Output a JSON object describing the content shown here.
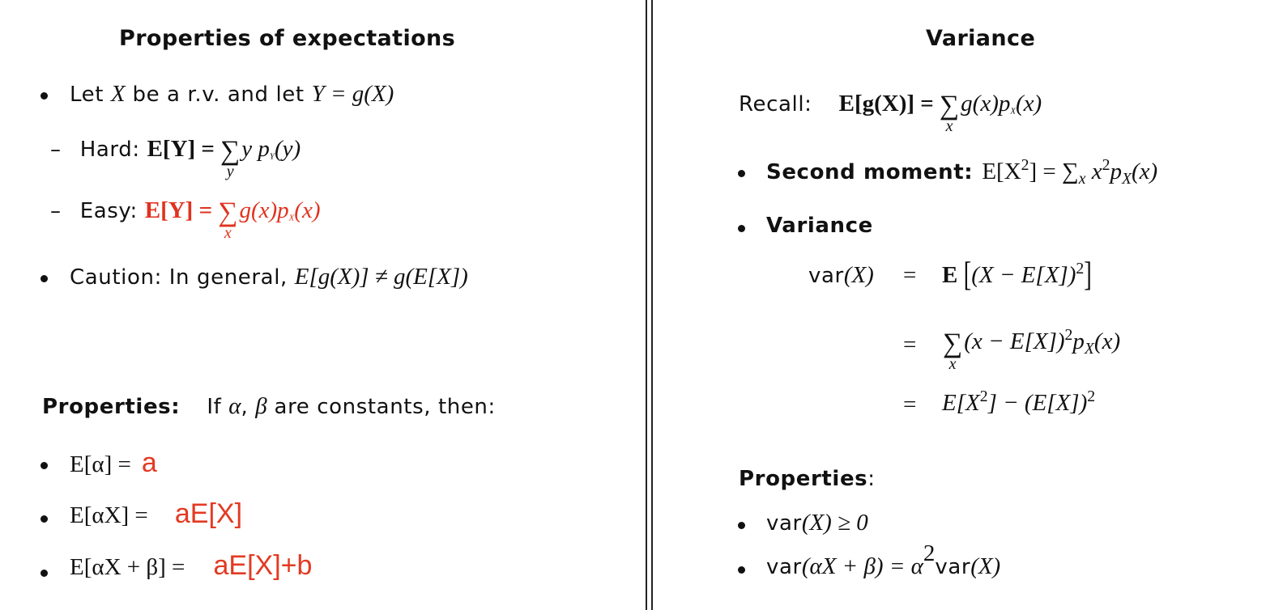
{
  "left": {
    "title": "Properties of expectations",
    "item1": {
      "text1": "Let ",
      "X": "X",
      "text2": " be a r.v. and let ",
      "expr": "Y = g(X)"
    },
    "hard": {
      "dash": "–",
      "label": "Hard: ",
      "lhs": "E[Y] =",
      "sum_sub": "y",
      "rhs": "y p",
      "rhs_sub": "Y",
      "rhs_end": "(y)"
    },
    "easy": {
      "dash": "–",
      "label": "Easy: ",
      "lhs": "E[Y] =",
      "sum_sub": "x",
      "rhs": "g(x)p",
      "rhs_sub": "X",
      "rhs_end": "(x)"
    },
    "caution": {
      "text": "Caution: In general, ",
      "expr": "E[g(X)] ≠ g(E[X])"
    },
    "properties": {
      "label": "Properties:",
      "text1": "If ",
      "alpha": "α",
      "comma": ", ",
      "beta": "β",
      "text2": " are constants, then:"
    },
    "prop1": {
      "expr": "E[α] =",
      "handwritten": "a"
    },
    "prop2": {
      "expr": "E[αX] =",
      "handwritten": "aE[X]"
    },
    "prop3": {
      "expr": "E[αX + β] =",
      "handwritten": "aE[X]+b"
    }
  },
  "right": {
    "title": "Variance",
    "recall": {
      "label": "Recall:",
      "lhs": "E[g(X)] =",
      "sum_sub": "x",
      "rhs": "g(x)p",
      "rhs_sub": "X",
      "rhs_end": "(x)"
    },
    "second_moment": {
      "label": "Second moment:",
      "lhs": "E[X",
      "sup": "2",
      "mid": "] = ∑",
      "sum_sub": "x",
      "rhs": " x",
      "rhs_sup": "2",
      "rhs2": "p",
      "rhs_sub": "X",
      "rhs_end": "(x)"
    },
    "variance_label": "Variance",
    "var_lhs_word": "var",
    "var_lhs_arg": "(X)",
    "eq": "=",
    "line1": {
      "E": "E",
      "body": "(X − E[X])",
      "sup": "2"
    },
    "line2": {
      "sum_sub": "x",
      "body": "(x − E[X])",
      "sup": "2",
      "p": "p",
      "p_sub": "X",
      "end": "(x)"
    },
    "line3": {
      "a": "E[X",
      "sup1": "2",
      "b": "] − (E[X])",
      "sup2": "2"
    },
    "properties_label": "Properties",
    "properties_colon": ":",
    "prop1": {
      "word": "var",
      "expr": "(X) ≥ 0"
    },
    "prop2": {
      "word": "var",
      "expr1": "(αX + β) = α",
      "sup": "2",
      "word2": "var",
      "expr2": "(X)"
    }
  },
  "colors": {
    "red": "#e0321e",
    "text": "#111111",
    "divider": "#222222"
  }
}
